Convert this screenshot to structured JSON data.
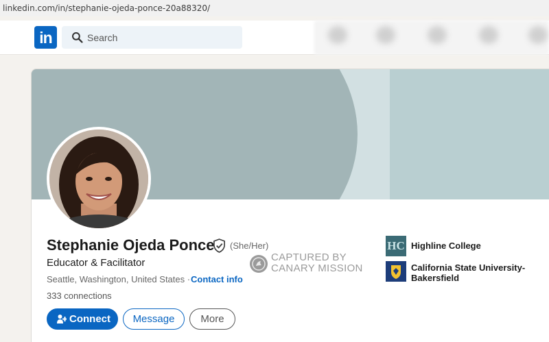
{
  "browser": {
    "url": "linkedin.com/in/stephanie-ojeda-ponce-20a88320/"
  },
  "nav": {
    "logo_text": "in",
    "search_placeholder": "Search"
  },
  "profile": {
    "name": "Stephanie Ojeda Ponce",
    "pronouns": "(She/Her)",
    "headline": "Educator & Facilitator",
    "location": "Seattle, Washington, United States",
    "separator": "·",
    "contact_info_label": "Contact info",
    "connections": "333 connections"
  },
  "actions": {
    "connect_label": "Connect",
    "message_label": "Message",
    "more_label": "More"
  },
  "watermark": {
    "line1": "CAPTURED BY",
    "line2": "CANARY MISSION"
  },
  "education": [
    {
      "name": "Highline College",
      "logo_text": "HC"
    },
    {
      "name_line1": "California State University-",
      "name_line2": "Bakersfield"
    }
  ],
  "colors": {
    "brand_blue": "#0a66c2",
    "banner_dark": "#a2b5b7",
    "banner_light": "#d2e0e2"
  }
}
